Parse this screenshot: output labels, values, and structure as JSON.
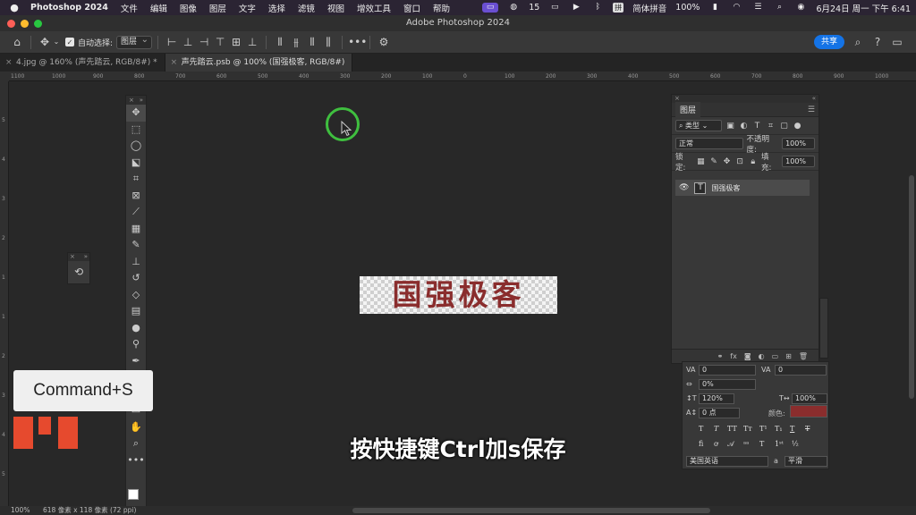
{
  "menubar": {
    "app_name": "Photoshop 2024",
    "items": [
      "文件",
      "编辑",
      "图像",
      "图层",
      "文字",
      "选择",
      "滤镜",
      "视图",
      "增效工具",
      "窗口",
      "帮助"
    ],
    "wechat_count": "15",
    "input_method": "简体拼音",
    "battery": "100%",
    "datetime": "6月24日 周一  下午 6:41"
  },
  "titlebar": {
    "title": "Adobe Photoshop 2024"
  },
  "options": {
    "auto_select_label": "自动选择:",
    "auto_select_target": "图层",
    "share_label": "共享"
  },
  "tabs": [
    {
      "label": "4.jpg @ 160% (声先踏云, RGB/8#) *",
      "active": false
    },
    {
      "label": "声先踏云.psb @ 100% (国强极客, RGB/8#)",
      "active": true
    }
  ],
  "rulers": {
    "h_ticks": [
      "1100",
      "1000",
      "900",
      "800",
      "700",
      "600",
      "500",
      "400",
      "300",
      "200",
      "100",
      "0",
      "100",
      "200",
      "300",
      "400",
      "500",
      "600",
      "700",
      "800",
      "900",
      "1000",
      "1100"
    ],
    "v_ticks": [
      "5",
      "4",
      "3",
      "2",
      "1",
      "1",
      "2",
      "3",
      "4",
      "5"
    ]
  },
  "canvas": {
    "text": "国强极客",
    "text_color": "#8a2d2d"
  },
  "overlay": {
    "keystroke": "Command+S",
    "subtitle": "按快捷键Ctrl加s保存",
    "logo_color": "#e64a2e"
  },
  "layers": {
    "tab_label": "图层",
    "filter_kind": "类型",
    "blend_mode": "正常",
    "opacity_label": "不透明度:",
    "opacity_value": "100%",
    "lock_label": "锁定:",
    "fill_label": "填充:",
    "fill_value": "100%",
    "layer_name": "国强极客",
    "layer_thumb_glyph": "T"
  },
  "character": {
    "tracking": "0",
    "kerning": "0",
    "tsume": "0%",
    "vertical_scale": "120%",
    "horizontal_scale": "100%",
    "baseline_shift": "0 点",
    "color_label": "颜色:",
    "text_color": "#8a2d2d",
    "language": "美国英语",
    "aa_prefix": "a",
    "antialias": "平滑"
  },
  "status": {
    "zoom": "100%",
    "doc_size": "618 像素 x 118 像素 (72 ppi)"
  }
}
